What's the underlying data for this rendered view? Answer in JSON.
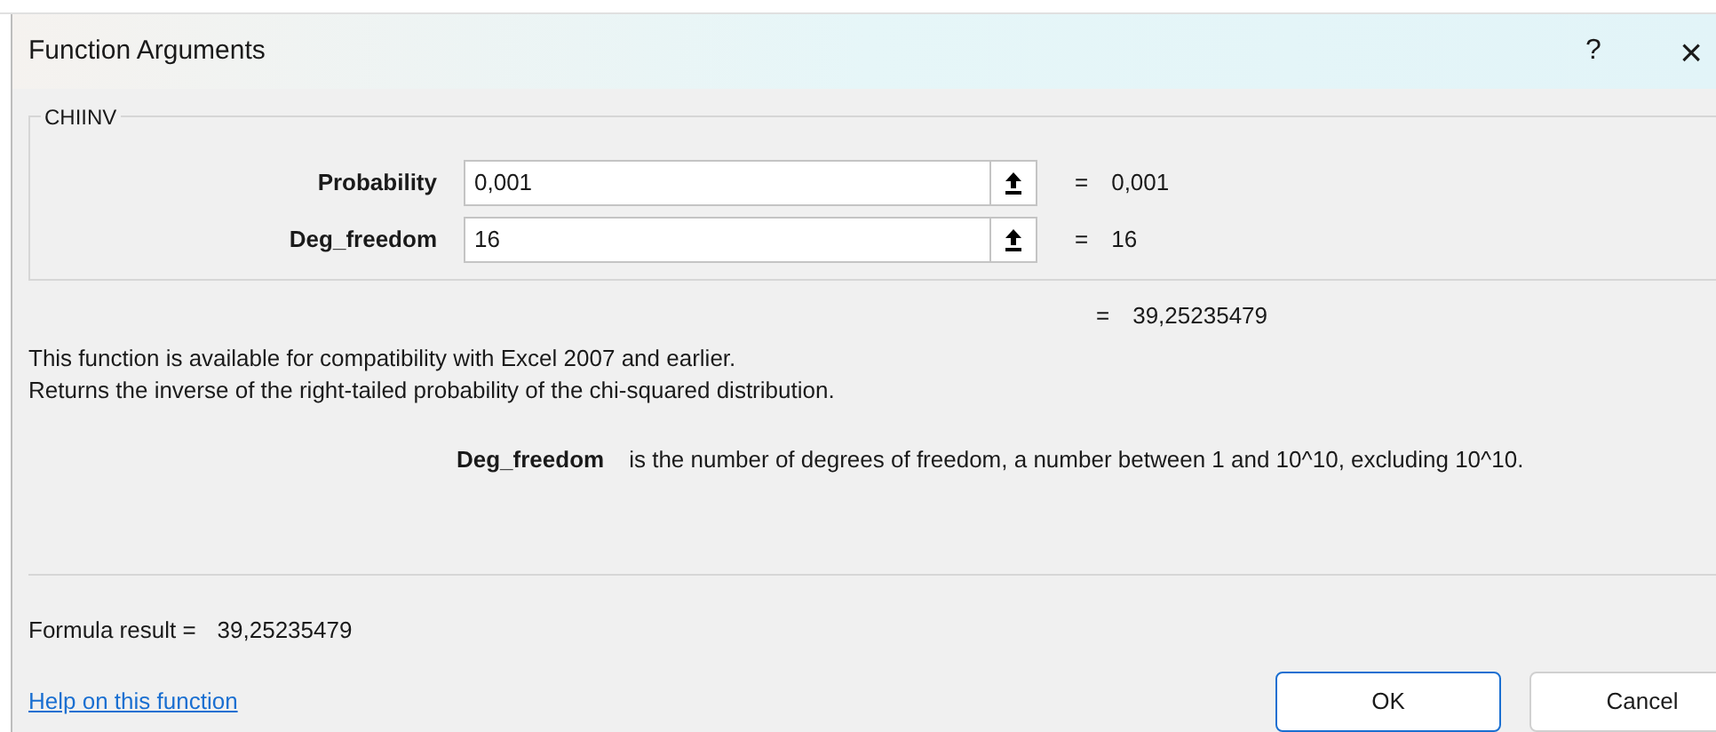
{
  "window": {
    "title": "Function Arguments",
    "help_button": "?",
    "close_button": "×"
  },
  "function_name": "CHIINV",
  "arguments": [
    {
      "label": "Probability",
      "value": "0,001",
      "equals": "=",
      "result": "0,001"
    },
    {
      "label": "Deg_freedom",
      "value": "16",
      "equals": "=",
      "result": "16"
    }
  ],
  "total": {
    "equals": "=",
    "result": "39,25235479"
  },
  "description": [
    "This function is available for compatibility with Excel 2007 and earlier.",
    "Returns the inverse of the right-tailed probability of the chi-squared distribution."
  ],
  "argument_help": {
    "name": "Deg_freedom",
    "text": "is the number of degrees of freedom, a number between 1 and 10^10, excluding 10^10."
  },
  "formula_result": {
    "label": "Formula result =",
    "value": "39,25235479"
  },
  "help_link": "Help on this function",
  "buttons": [
    {
      "label": "OK",
      "kind": "default"
    },
    {
      "label": "Cancel",
      "kind": "normal"
    }
  ]
}
